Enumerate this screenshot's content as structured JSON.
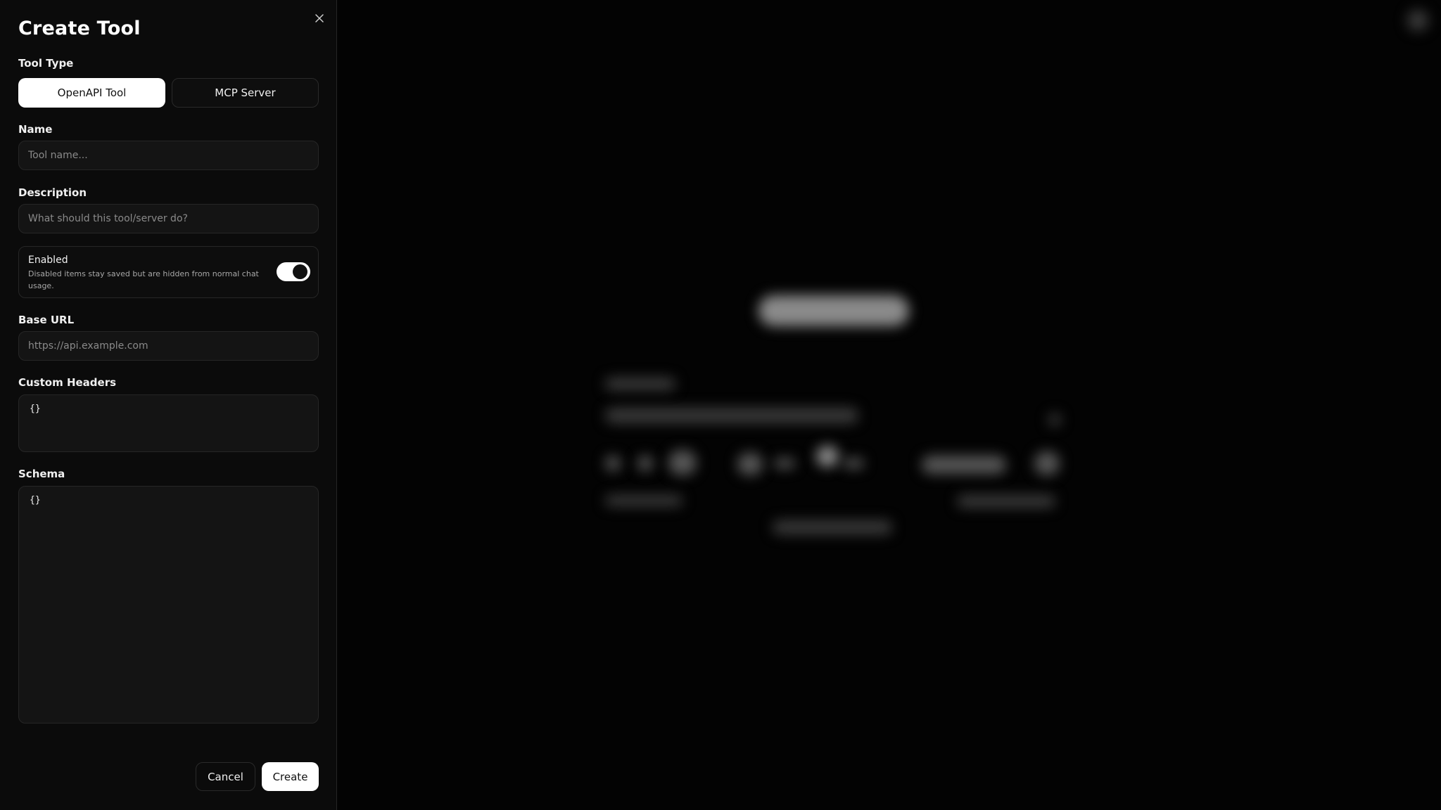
{
  "dialog": {
    "title": "Create Tool",
    "close_icon": "close-icon"
  },
  "tool_type": {
    "label": "Tool Type",
    "options": [
      "OpenAPI Tool",
      "MCP Server"
    ],
    "selected": "OpenAPI Tool"
  },
  "name": {
    "label": "Name",
    "value": "",
    "placeholder": "Tool name..."
  },
  "description": {
    "label": "Description",
    "value": "",
    "placeholder": "What should this tool/server do?"
  },
  "enabled": {
    "title": "Enabled",
    "description": "Disabled items stay saved but are hidden from normal chat usage.",
    "value": true
  },
  "base_url": {
    "label": "Base URL",
    "value": "",
    "placeholder": "https://api.example.com"
  },
  "custom_headers": {
    "label": "Custom Headers",
    "value": "{}"
  },
  "schema": {
    "label": "Schema",
    "value": "{}"
  },
  "actions": {
    "cancel_label": "Cancel",
    "create_label": "Create"
  },
  "colors": {
    "panel_background": "#0b0b0b",
    "page_background": "#030303",
    "accent": "#ffffff",
    "field_background": "#141414"
  }
}
